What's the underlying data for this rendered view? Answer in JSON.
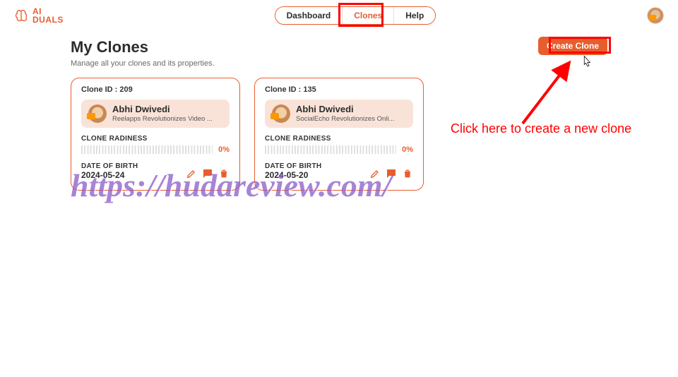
{
  "brand": {
    "line1": "AI",
    "line2": "DUALS"
  },
  "nav": {
    "items": [
      {
        "label": "Dashboard",
        "active": false
      },
      {
        "label": "Clones",
        "active": true
      },
      {
        "label": "Help",
        "active": false
      }
    ]
  },
  "header": {
    "create_label": "Create Clone"
  },
  "page": {
    "title": "My Clones",
    "subtitle": "Manage all your clones and its properties."
  },
  "clones": [
    {
      "id_label": "Clone ID :",
      "id": "209",
      "owner_name": "Abhi Dwivedi",
      "owner_tag": "Reelapps Revolutionizes Video ...",
      "radiness_label": "CLONE RADINESS",
      "radiness_pct": "0%",
      "dob_label": "DATE OF BIRTH",
      "dob": "2024-05-24"
    },
    {
      "id_label": "Clone ID :",
      "id": "135",
      "owner_name": "Abhi Dwivedi",
      "owner_tag": "SocialEcho Revolutionizes Onli...",
      "radiness_label": "CLONE RADINESS",
      "radiness_pct": "0%",
      "dob_label": "DATE OF BIRTH",
      "dob": "2024-05-20"
    }
  ],
  "annotation": {
    "callout": "Click here to create a new clone",
    "watermark": "https://hudareview.com/"
  }
}
